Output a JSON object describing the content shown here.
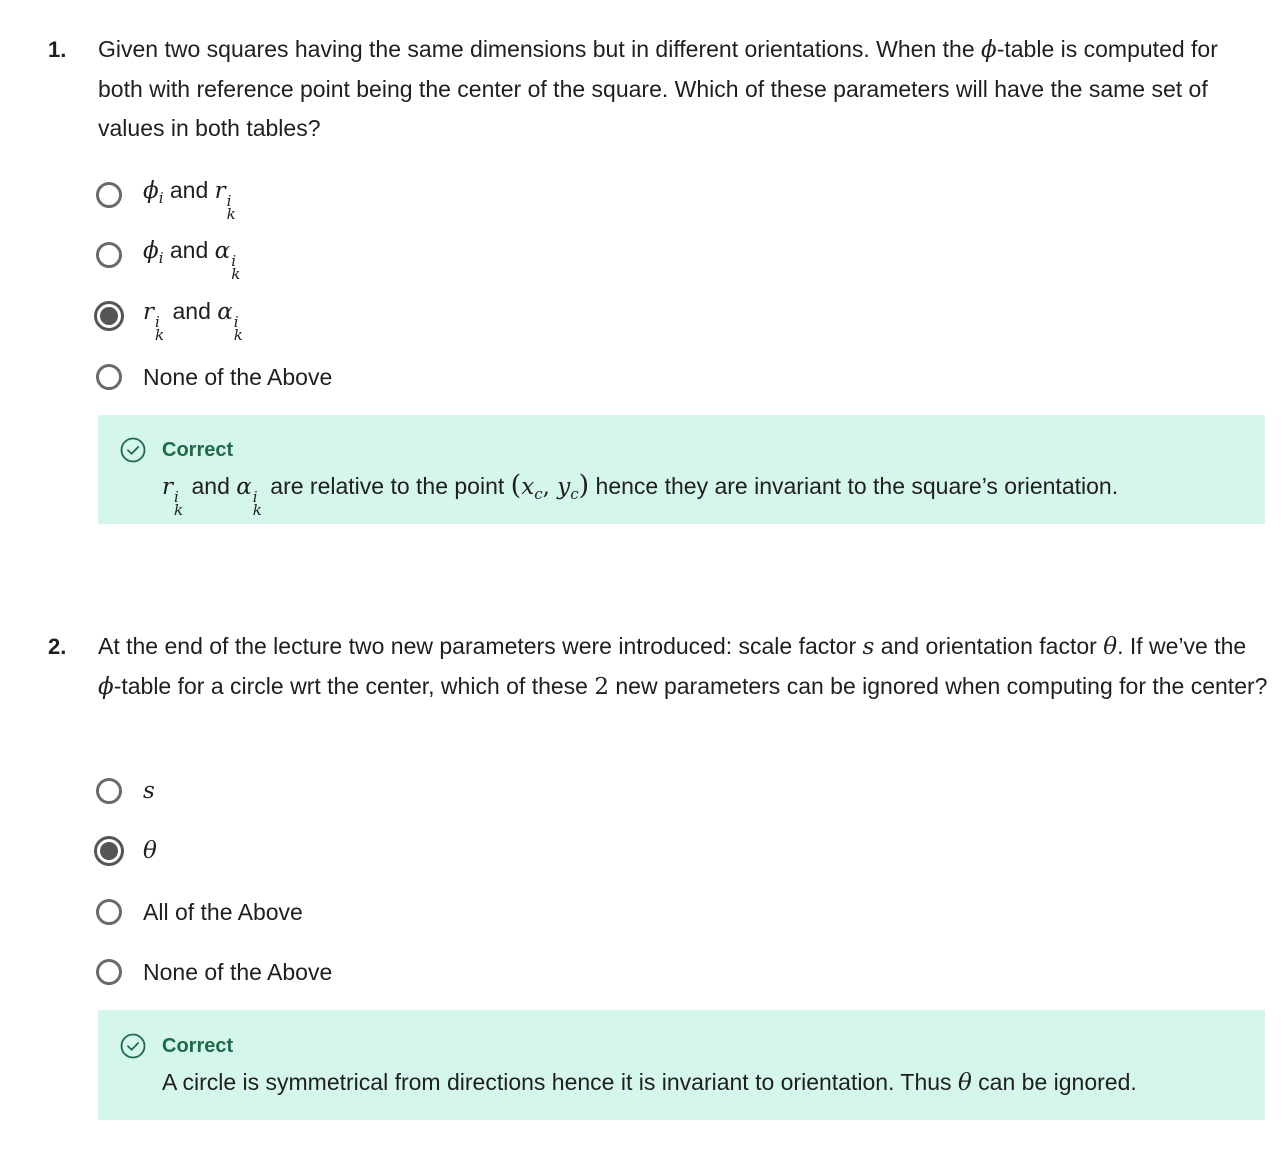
{
  "questions": [
    {
      "number": "1.",
      "text": {
        "p1": "Given two squares having the same dimensions but in different orientations. When the ",
        "phi": "ϕ",
        "p2": "-table is computed for both with reference point being the center of the square. Which of these parameters will have the same set of values in both tables?"
      },
      "options": [
        {
          "sym1": "ϕ",
          "sym1_sub": "i",
          "connector": " and ",
          "sym2": "r",
          "sym2_sup": "i",
          "sym2_sub": "k",
          "selected": false
        },
        {
          "sym1": "ϕ",
          "sym1_sub": "i",
          "connector": " and ",
          "sym2": "α",
          "sym2_sup": "i",
          "sym2_sub": "k",
          "selected": false
        },
        {
          "sym1": "r",
          "sym1_sup": "i",
          "sym1_sub": "k",
          "connector": " and ",
          "sym2": "α",
          "sym2_sup": "i",
          "sym2_sub": "k",
          "selected": true
        },
        {
          "label": "None of the Above",
          "selected": false
        }
      ],
      "feedback": {
        "status": "Correct",
        "sym1": "r",
        "sym1_sup": "i",
        "sym1_sub": "k",
        "connector": " and ",
        "sym2": "α",
        "sym2_sup": "i",
        "sym2_sub": "k",
        "mid": " are relative to the point ",
        "point_open": "(",
        "xc": "x",
        "xc_sub": "c",
        "comma": ", ",
        "yc": "y",
        "yc_sub": "c",
        "point_close": ")",
        "tail": " hence they are invariant to the square’s orientation."
      }
    },
    {
      "number": "2.",
      "text": {
        "p1": "At the end of the lecture two new parameters were introduced: scale factor ",
        "s": "s",
        "p2": " and orientation factor ",
        "theta": "θ",
        "p3": ". If we’ve the ",
        "phi": "ϕ",
        "p4": "-table for a circle wrt the center, which of these ",
        "two": "2",
        "p5": " new parameters can be ignored when computing for the center?"
      },
      "options": [
        {
          "sym": "s",
          "selected": false
        },
        {
          "sym": "θ",
          "selected": true
        },
        {
          "label": "All of the Above",
          "selected": false
        },
        {
          "label": "None of the Above",
          "selected": false
        }
      ],
      "feedback": {
        "status": "Correct",
        "p1": "A circle is symmetrical from directions hence it is invariant to orientation. Thus ",
        "theta": "θ",
        "p2": " can be ignored."
      }
    }
  ],
  "colors": {
    "feedback_bg": "#d5f6ea",
    "correct_green": "#1d6b48",
    "radio_border": "#6a6a6a"
  },
  "icons": {
    "feedback_icon": "check-circle-icon",
    "radio_unselected": "radio-empty",
    "radio_selected": "radio-filled"
  }
}
